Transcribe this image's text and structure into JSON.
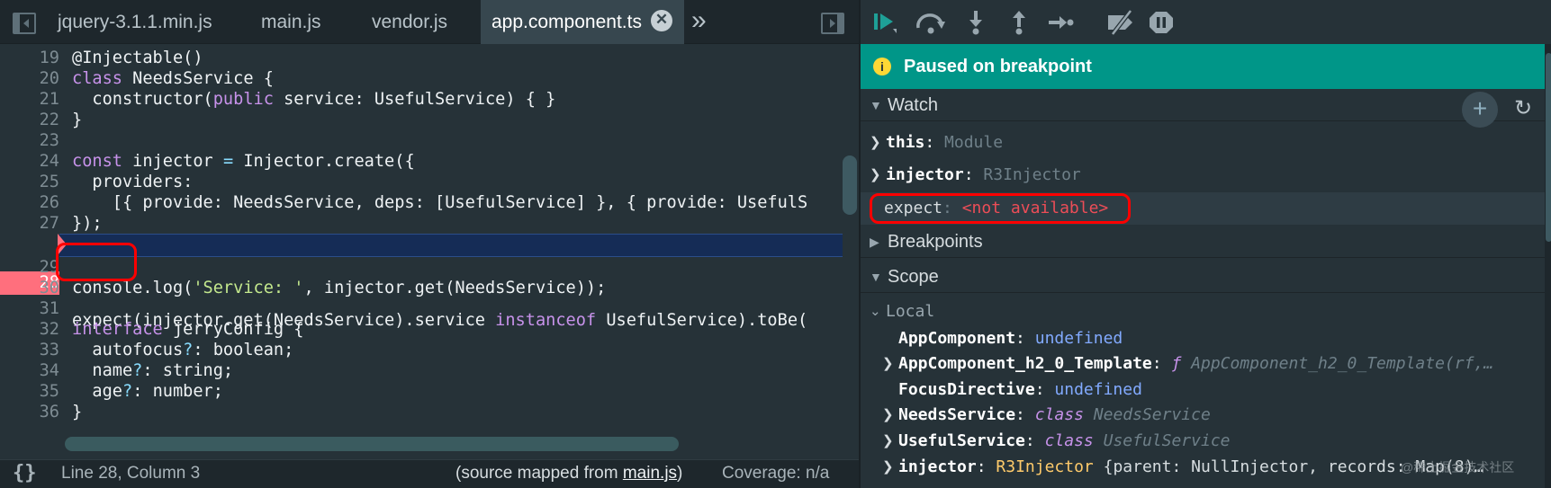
{
  "editor": {
    "tabs": [
      {
        "label": "jquery-3.1.1.min.js",
        "active": false
      },
      {
        "label": "main.js",
        "active": false
      },
      {
        "label": "vendor.js",
        "active": false
      },
      {
        "label": "app.component.ts",
        "active": true
      }
    ],
    "tab_close_glyph": "✕",
    "overflow_glyph": "»",
    "line_numbers": [
      "19",
      "20",
      "21",
      "22",
      "23",
      "24",
      "25",
      "26",
      "27",
      "28",
      "29",
      "30",
      "31",
      "32",
      "33",
      "34",
      "35",
      "36"
    ],
    "breakpoint_line": "28",
    "code": {
      "l19": "@Injectable()",
      "l20_kw": "class",
      "l20_rest": " NeedsService {",
      "l21_a": "  constructor(",
      "l21_kw": "public",
      "l21_b": " service: UsefulService) { }",
      "l22": "}",
      "l24_kw": "const",
      "l24_a": " injector ",
      "l24_op": "=",
      "l24_b": " Injector.create({",
      "l25": "  providers:",
      "l26": "    [{ provide: NeedsService, deps: [UsefulService] }, { provide: UsefulS",
      "l27": "});",
      "l28_a": "expect",
      "l28_b": "(injector.get(NeedsService).service ",
      "l28_kw": "instanceof",
      "l28_c": " UsefulService).toBe(",
      "l30_a": "console.log(",
      "l30_str": "'Service: '",
      "l30_b": ", injector.get(NeedsService));",
      "l32_kw": "interface",
      "l32_rest": " jerryConfig {",
      "l33_a": "  autofocus",
      "l33_op": "?",
      "l33_b": ": boolean;",
      "l34_a": "  name",
      "l34_op": "?",
      "l34_b": ": string;",
      "l35_a": "  age",
      "l35_op": "?",
      "l35_b": ": number;",
      "l36": "}"
    },
    "status": {
      "braces": "{}",
      "position": "Line 28, Column 3",
      "mapped_prefix": "(source mapped from ",
      "mapped_file": "main.js",
      "mapped_suffix": ")",
      "coverage": "Coverage: n/a"
    }
  },
  "debugger": {
    "toolbar_icons": [
      "resume-icon",
      "step-over-icon",
      "step-into-icon",
      "step-out-icon",
      "step-icon",
      "deactivate-breakpoints-icon",
      "pause-on-exceptions-icon"
    ],
    "paused_label": "Paused on breakpoint",
    "info_glyph": "i",
    "watch": {
      "title": "Watch",
      "add_glyph": "+",
      "refresh_glyph": "↻",
      "items": [
        {
          "name": "this",
          "value": "Module"
        },
        {
          "name": "injector",
          "value": "R3Injector"
        },
        {
          "name": "expect",
          "value": "<not available>"
        }
      ]
    },
    "breakpoints_title": "Breakpoints",
    "scope": {
      "title": "Scope",
      "local_label": "Local",
      "items": [
        {
          "name": "AppComponent",
          "value": "undefined"
        },
        {
          "name": "AppComponent_h2_0_Template",
          "prefix": "ƒ",
          "value": "AppComponent_h2_0_Template(rf,…"
        },
        {
          "name": "FocusDirective",
          "value": "undefined"
        },
        {
          "name": "NeedsService",
          "prefix": "class",
          "value": "NeedsService"
        },
        {
          "name": "UsefulService",
          "prefix": "class",
          "value": "UsefulService"
        },
        {
          "name": "injector",
          "prefix": "R3Injector",
          "value_a": "{parent: NullInjector, records: Map(8)…"
        }
      ]
    },
    "watermark": "@稀土掘金技术社区"
  },
  "colors": {
    "accent": "#009688",
    "breakpoint": "#ff6f7d",
    "highlight_box": "#ff0000",
    "error_value": "#ec4d57"
  }
}
